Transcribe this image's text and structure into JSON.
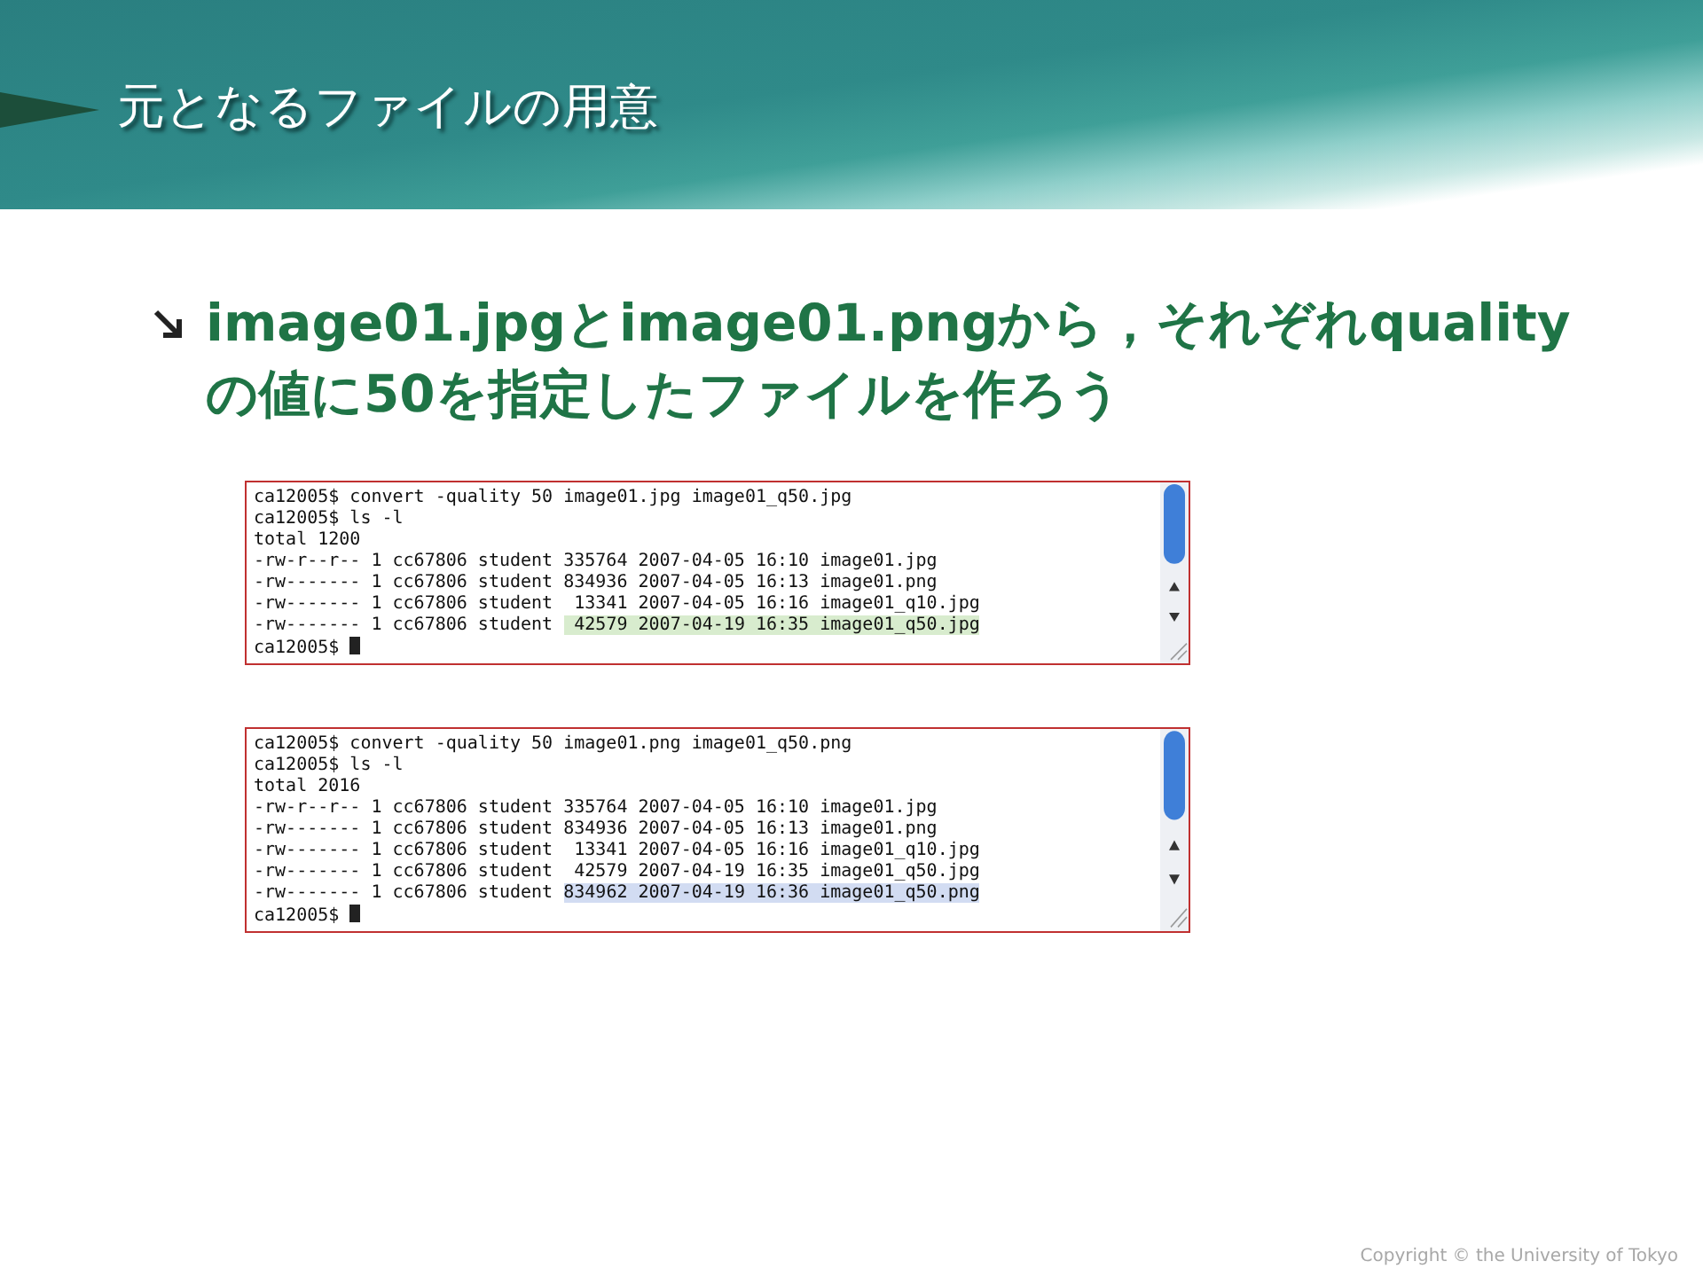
{
  "slide": {
    "title": "元となるファイルの用意",
    "bullet": "**image01.jpg**と**image01.png**から，それぞれ**quality**の値に**50**を指定したファイルを作ろう",
    "terminals": [
      {
        "lines": [
          {
            "text": "ca12005$ convert -quality 50 image01.jpg image01_q50.jpg"
          },
          {
            "text": "ca12005$ ls -l"
          },
          {
            "text": "total 1200"
          },
          {
            "text": "-rw-r--r-- 1 cc67806 student 335764 2007-04-05 16:10 image01.jpg"
          },
          {
            "text": "-rw------- 1 cc67806 student 834936 2007-04-05 16:13 image01.png"
          },
          {
            "text": "-rw------- 1 cc67806 student  13341 2007-04-05 16:16 image01_q10.jpg"
          },
          {
            "text": "-rw------- 1 cc67806 student ",
            "highlight": " 42579 2007-04-19 16:35 image01_q50.jpg",
            "color": "#d8ecce"
          }
        ],
        "prompt": "ca12005$"
      },
      {
        "lines": [
          {
            "text": "ca12005$ convert -quality 50 image01.png image01_q50.png"
          },
          {
            "text": "ca12005$ ls -l"
          },
          {
            "text": "total 2016"
          },
          {
            "text": "-rw-r--r-- 1 cc67806 student 335764 2007-04-05 16:10 image01.jpg"
          },
          {
            "text": "-rw------- 1 cc67806 student 834936 2007-04-05 16:13 image01.png"
          },
          {
            "text": "-rw------- 1 cc67806 student  13341 2007-04-05 16:16 image01_q10.jpg"
          },
          {
            "text": "-rw------- 1 cc67806 student  42579 2007-04-19 16:35 image01_q50.jpg"
          },
          {
            "text": "-rw------- 1 cc67806 student ",
            "highlight": "834962 2007-04-19 16:36 image01_q50.png",
            "color": "#d2dcf2"
          }
        ],
        "prompt": "ca12005$"
      }
    ],
    "copyright": "Copyright © the University of Tokyo"
  }
}
